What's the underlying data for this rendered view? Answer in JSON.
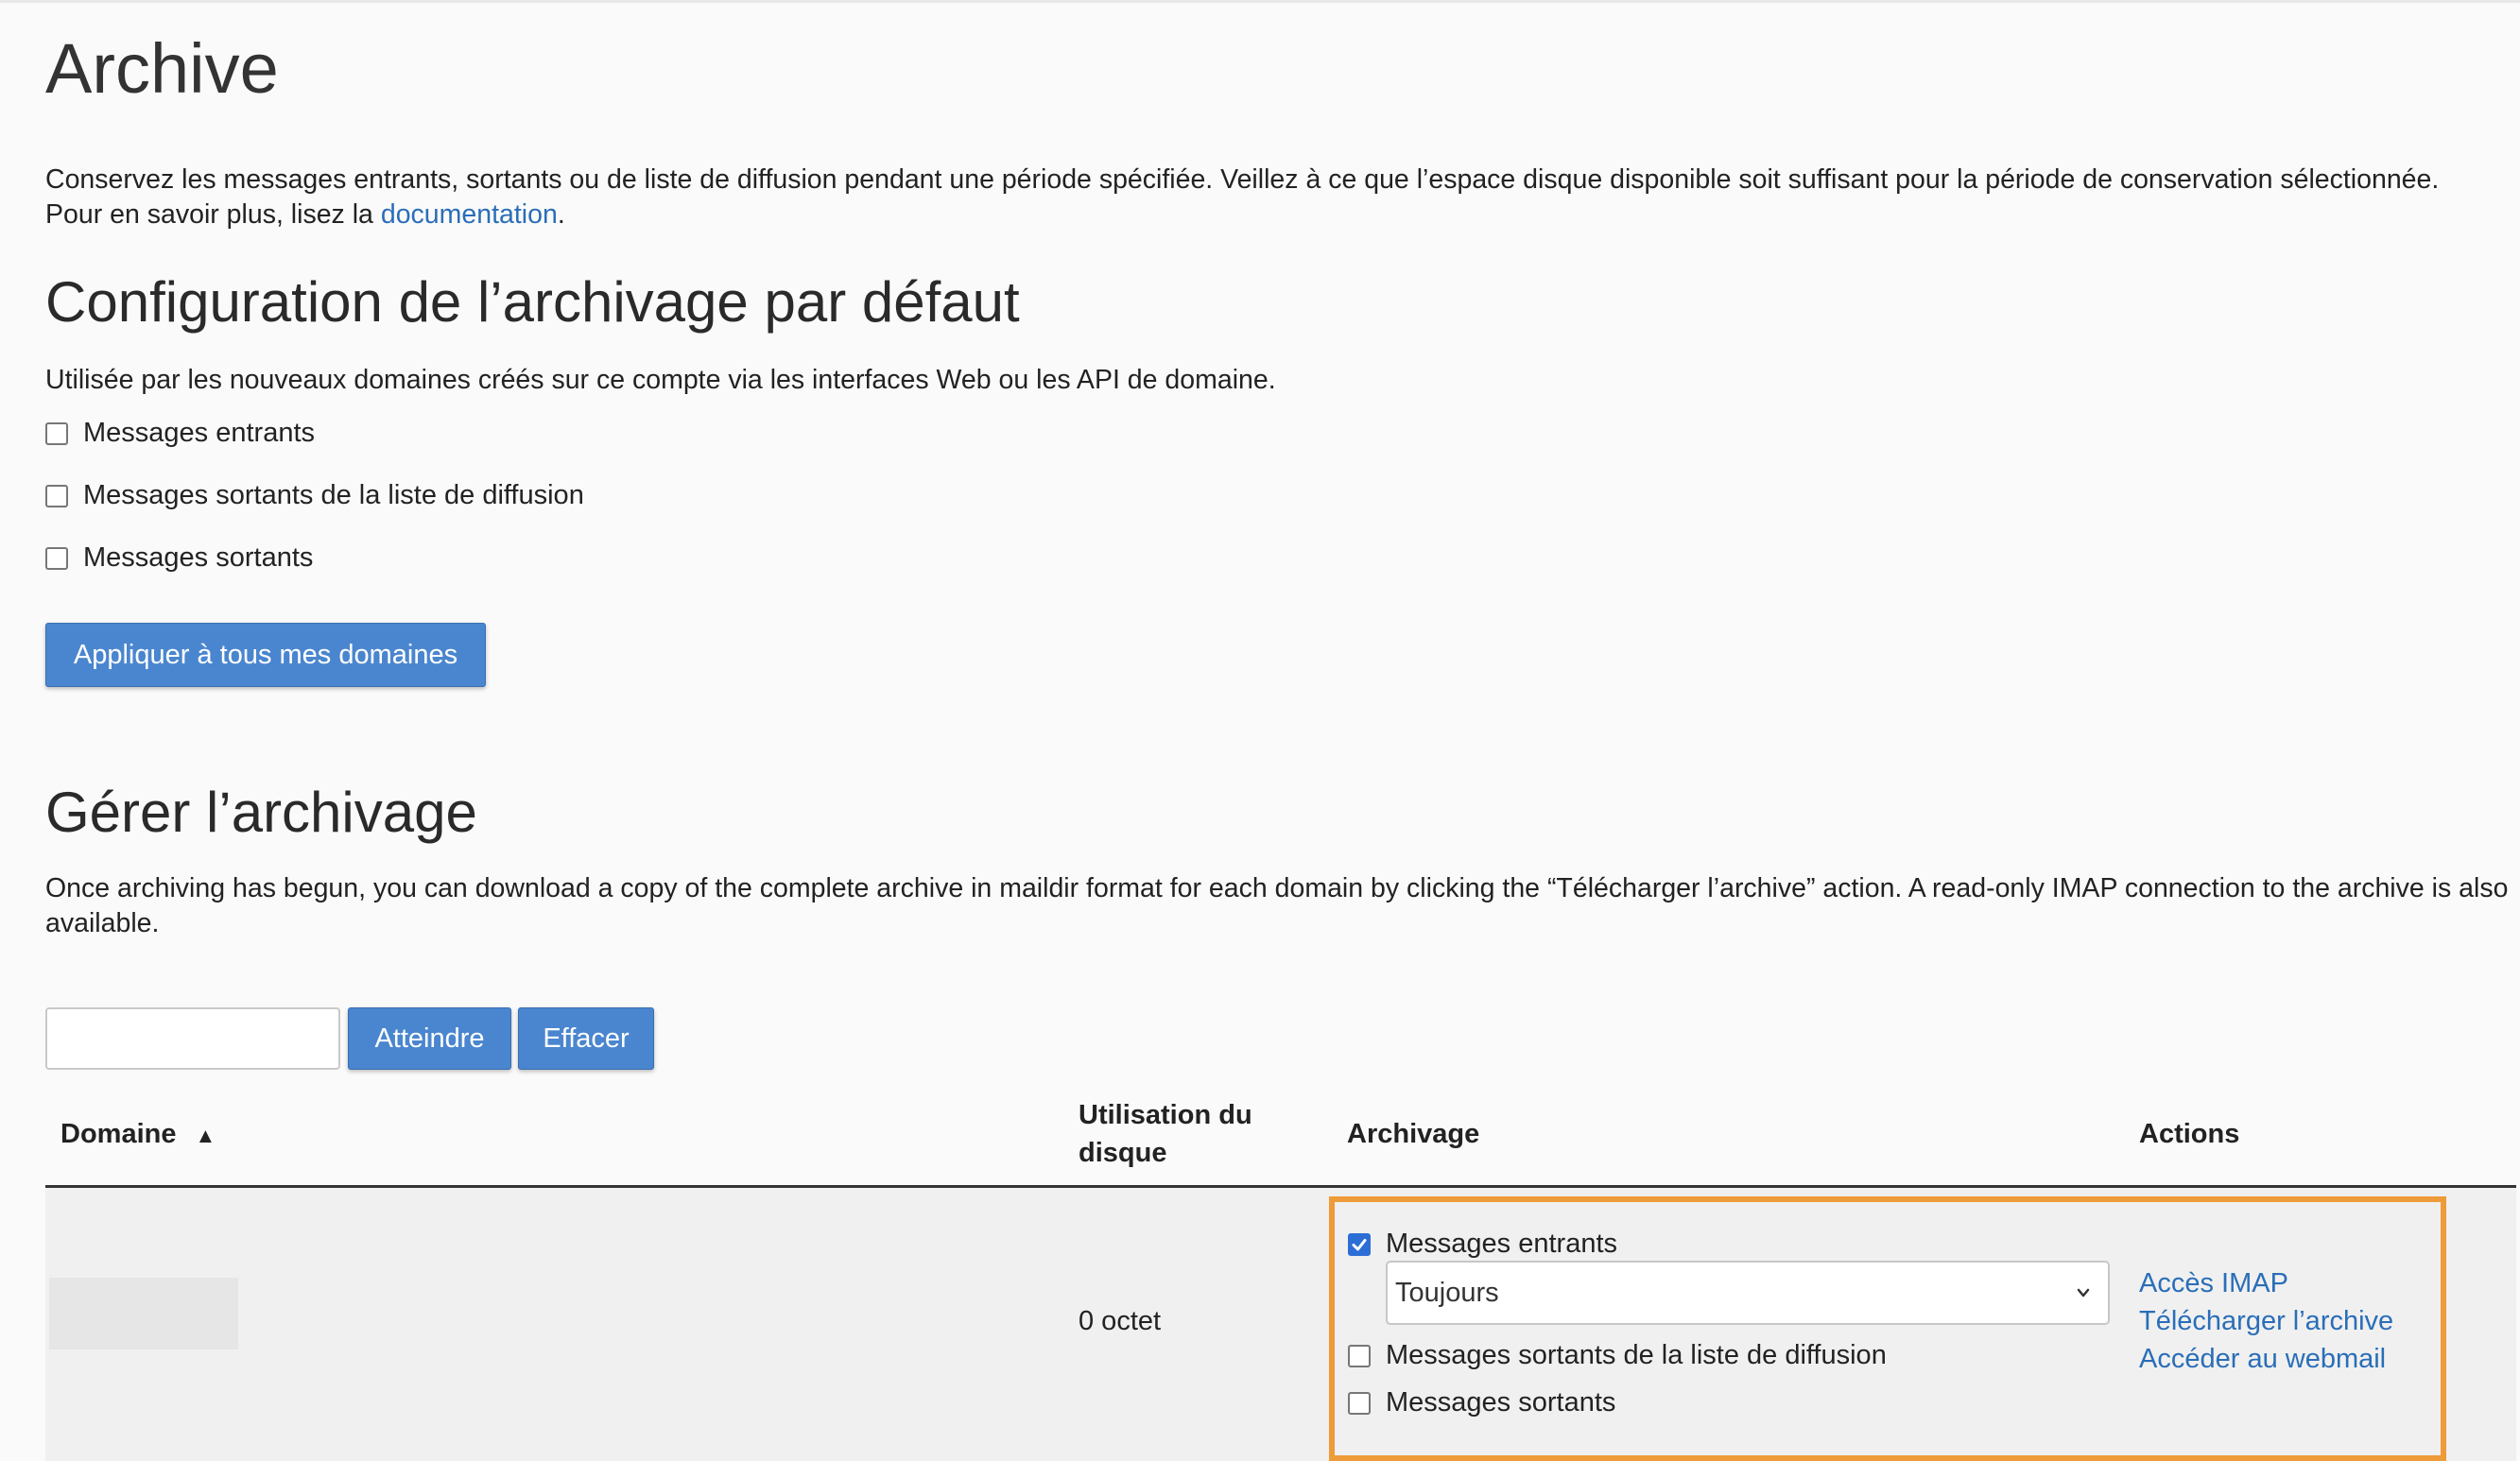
{
  "page": {
    "title": "Archive",
    "intro_line1": "Conservez les messages entrants, sortants ou de liste de diffusion pendant une période spécifiée. Veillez à ce que l’espace disque disponible soit suffisant pour la période de conservation sélectionnée.",
    "intro_line2_prefix": "Pour en savoir plus, lisez la ",
    "intro_link": "documentation",
    "intro_line2_suffix": "."
  },
  "default_config": {
    "heading": "Configuration de l’archivage par défaut",
    "description": "Utilisée par les nouveaux domaines créés sur ce compte via les interfaces Web ou les API de domaine.",
    "options": [
      {
        "label": "Messages entrants",
        "checked": false
      },
      {
        "label": "Messages sortants de la liste de diffusion",
        "checked": false
      },
      {
        "label": "Messages sortants",
        "checked": false
      }
    ],
    "apply_button": "Appliquer à tous mes domaines"
  },
  "manage": {
    "heading": "Gérer l’archivage",
    "description": "Once archiving has begun, you can download a copy of the complete archive in maildir format for each domain by clicking the “Télécharger l’archive” action. A read-only IMAP connection to the archive is also available.",
    "search": {
      "value": "",
      "placeholder": ""
    },
    "go_button": "Atteindre",
    "clear_button": "Effacer"
  },
  "table": {
    "columns": {
      "domain": "Domaine",
      "sort_indicator": "▲",
      "disk_usage_line1": "Utilisation du",
      "disk_usage_line2": "disque",
      "archiving": "Archivage",
      "actions": "Actions"
    },
    "rows": [
      {
        "disk_usage": "0 octet",
        "archiving": {
          "incoming": {
            "label": "Messages entrants",
            "checked": true
          },
          "retention": "Toujours",
          "mailing_list": {
            "label": "Messages sortants de la liste de diffusion",
            "checked": false
          },
          "outgoing": {
            "label": "Messages sortants",
            "checked": false
          }
        },
        "actions": [
          "Accès IMAP",
          "Télécharger l’archive",
          "Accéder au webmail"
        ]
      }
    ]
  },
  "colors": {
    "accent": "#4a86cf",
    "link": "#2a6eb8",
    "highlight": "#ee9b3a"
  }
}
